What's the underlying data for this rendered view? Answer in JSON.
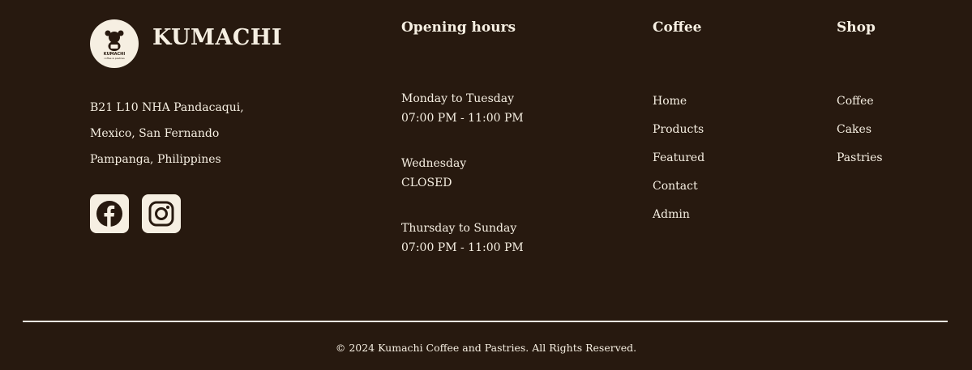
{
  "brand": {
    "name": "KUMACHI",
    "logo_text": "KUMACHI",
    "logo_subtext": "coffee & pastries"
  },
  "address": [
    "B21 L10 NHA Pandacaqui,",
    "Mexico, San Fernando",
    "Pampanga, Philippines"
  ],
  "social": [
    {
      "name": "facebook-icon"
    },
    {
      "name": "instagram-icon"
    }
  ],
  "hours": {
    "title": "Opening hours",
    "blocks": [
      {
        "days": "Monday to Tuesday",
        "time": "07:00 PM - 11:00 PM"
      },
      {
        "days": "Wednesday",
        "time": "CLOSED"
      },
      {
        "days": "Thursday to Sunday",
        "time": "07:00 PM - 11:00 PM"
      }
    ]
  },
  "coffee": {
    "title": "Coffee",
    "links": [
      "Home",
      "Products",
      "Featured",
      "Contact",
      "Admin"
    ]
  },
  "shop": {
    "title": "Shop",
    "links": [
      "Coffee",
      "Cakes",
      "Pastries"
    ]
  },
  "footer": {
    "copyright": "© 2024 Kumachi Coffee and Pastries. All Rights Reserved."
  },
  "colors": {
    "background": "#27190f",
    "text": "#f6efe2"
  }
}
